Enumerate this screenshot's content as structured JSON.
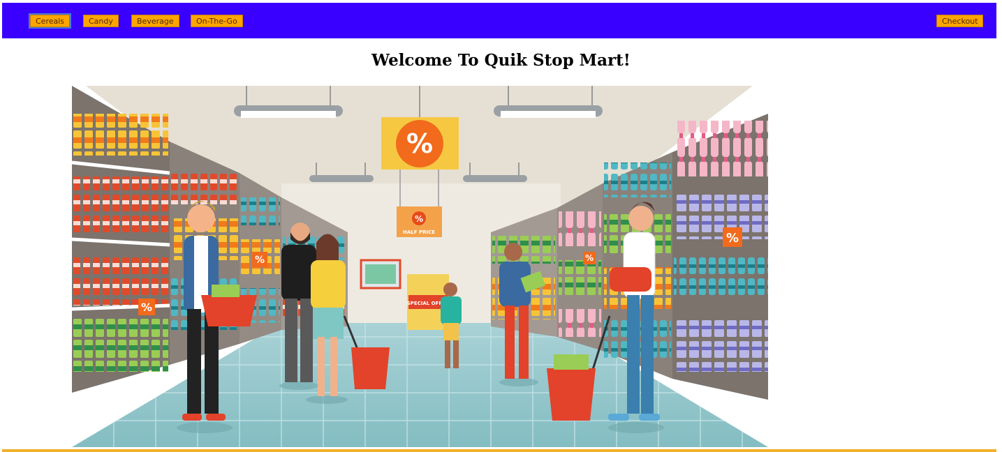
{
  "nav": {
    "items": [
      {
        "label": "Cereals"
      },
      {
        "label": "Candy"
      },
      {
        "label": "Beverage"
      },
      {
        "label": "On-The-Go"
      }
    ],
    "checkout_label": "Checkout"
  },
  "page": {
    "title": "Welcome To Quik Stop Mart!"
  },
  "hero": {
    "sign_text": "HALF PRICE",
    "special_offer_text": "SPECIAL OFFER"
  },
  "colors": {
    "nav_background": "#3a00ff",
    "button_background": "#ffa500",
    "accent_line": "#f0b02a"
  }
}
